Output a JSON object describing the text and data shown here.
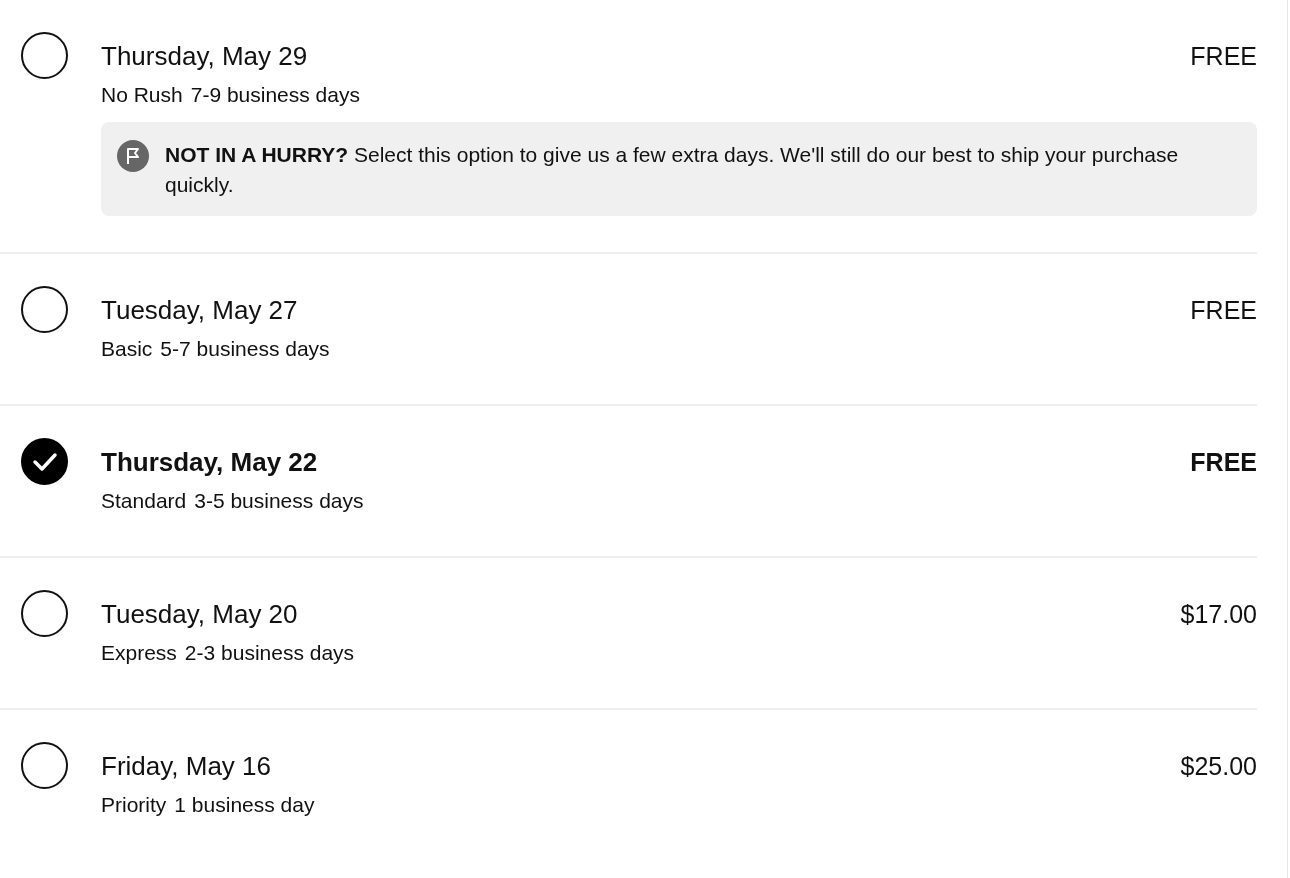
{
  "options": [
    {
      "date": "Thursday, May 29",
      "method": "No Rush",
      "duration": "7-9 business days",
      "price": "FREE",
      "selected": false,
      "note": "**NOT IN A HURRY?** Select this option to give us a few extra days. We'll still do our best to ship your purchase quickly."
    },
    {
      "date": "Tuesday, May 27",
      "method": "Basic",
      "duration": "5-7 business days",
      "price": "FREE",
      "selected": false
    },
    {
      "date": "Thursday, May 22",
      "method": "Standard",
      "duration": "3-5 business days",
      "price": "FREE",
      "selected": true
    },
    {
      "date": "Tuesday, May 20",
      "method": "Express",
      "duration": "2-3 business days",
      "price": "$17.00",
      "selected": false
    },
    {
      "date": "Friday, May 16",
      "method": "Priority",
      "duration": "1 business day",
      "price": "$25.00",
      "selected": false
    }
  ]
}
